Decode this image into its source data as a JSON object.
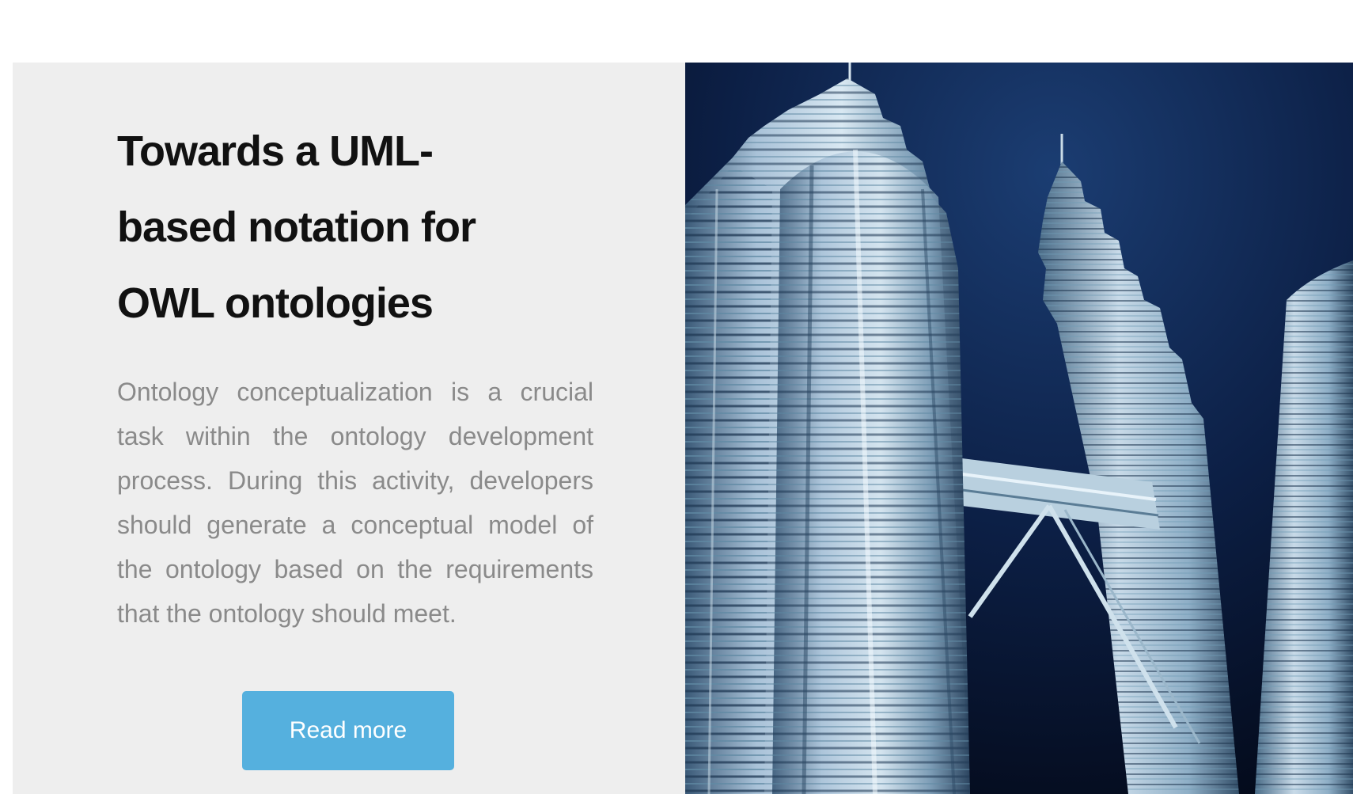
{
  "article": {
    "title": "Towards a UML-based notation for OWL ontologies",
    "excerpt": "Ontology conceptualization is a crucial task within the ontology development process. During this activity, developers should generate a conceptual model of the ontology based on the requirements that the ontology should meet.",
    "read_more_label": "Read more"
  },
  "image": {
    "subject": "petronas-twin-towers-night-photo"
  },
  "colors": {
    "card_background": "#eeeeee",
    "title": "#111111",
    "excerpt": "#8a8a8a",
    "button": "#55b0de",
    "button_text": "#ffffff"
  }
}
